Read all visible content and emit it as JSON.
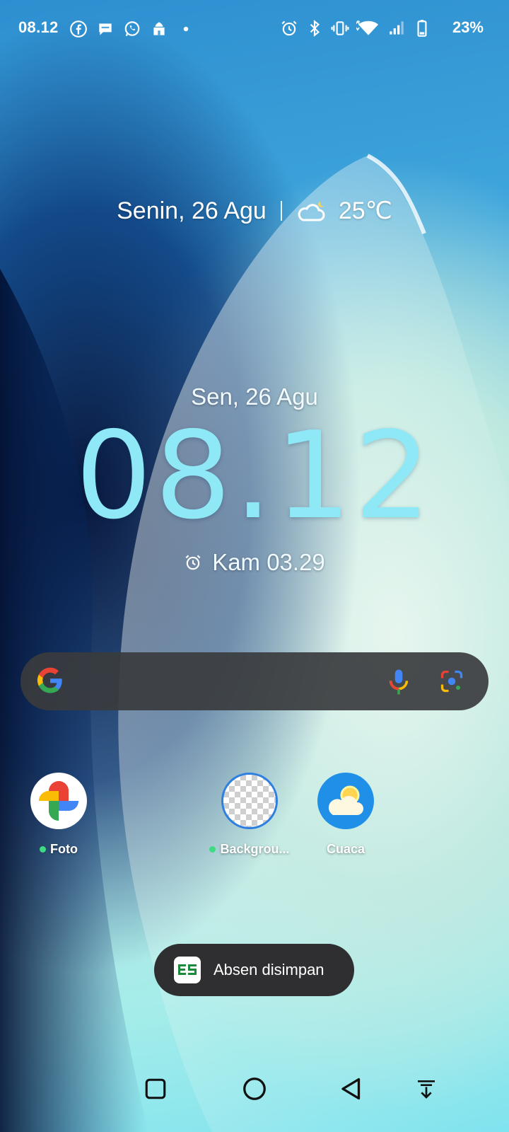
{
  "status_bar": {
    "time": "08.12",
    "battery_percent": "23%",
    "notification_icons": [
      "facebook-icon",
      "chat-bubble-icon",
      "whatsapp-icon",
      "mosque-icon",
      "dot-icon"
    ],
    "system_icons": [
      "alarm-icon",
      "bluetooth-icon",
      "vibrate-icon",
      "wifi-icon",
      "signal-icon",
      "battery-icon"
    ]
  },
  "date_weather": {
    "date": "Senin, 26 Agu",
    "temperature": "25℃",
    "weather_icon": "partly-cloudy-night-icon"
  },
  "clock_widget": {
    "date": "Sen, 26 Agu",
    "time": "08.12",
    "next_alarm": "Kam 03.29"
  },
  "search_bar": {
    "icons": [
      "google-g-icon",
      "microphone-icon",
      "google-lens-icon"
    ]
  },
  "apps": [
    {
      "label": "Foto",
      "has_new_dot": true,
      "icon": "google-photos-icon"
    },
    {
      "label": "Backgrou...",
      "has_new_dot": true,
      "icon": "transparent-background-icon"
    },
    {
      "label": "Cuaca",
      "has_new_dot": false,
      "icon": "weather-icon"
    }
  ],
  "toast": {
    "text": "Absen disimpan",
    "icon": "es-app-icon"
  },
  "nav_bar": {
    "buttons": [
      "recent-apps-button",
      "home-button",
      "back-button",
      "notification-pull-button"
    ]
  },
  "colors": {
    "clock": "#8fe8f6",
    "search_bg": "#3a3c3e",
    "toast_bg": "#2f2f31",
    "accent_green": "#3ddc84"
  }
}
